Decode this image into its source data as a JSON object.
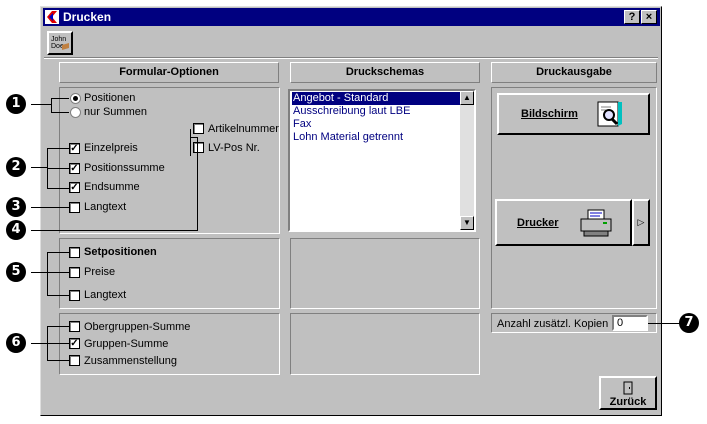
{
  "window": {
    "title": "Drucken",
    "help_button": "?",
    "close_button": "×"
  },
  "toolbar": {
    "john_doe_label": "John Doe"
  },
  "sections": {
    "formular_optionen": "Formular-Optionen",
    "druckschemas": "Druckschemas",
    "druckausgabe": "Druckausgabe"
  },
  "formular": {
    "positionen": "Positionen",
    "nur_summen": "nur Summen",
    "einzelpreis": "Einzelpreis",
    "positionssumme": "Positionssumme",
    "endsumme": "Endsumme",
    "langtext": "Langtext",
    "artikelnummer": "Artikelnummer",
    "lv_pos_nr": "LV-Pos Nr."
  },
  "setpositionen": {
    "title": "Setpositionen",
    "preise": "Preise",
    "langtext": "Langtext"
  },
  "gruppen": {
    "obergruppen_summe": "Obergruppen-Summe",
    "gruppen_summe": "Gruppen-Summe",
    "zusammenstellung": "Zusammenstellung"
  },
  "schemas": {
    "items": [
      "Angebot - Standard",
      "Ausschreibung laut LBE",
      "Fax",
      "Lohn Material getrennt"
    ],
    "selected_index": 0
  },
  "ausgabe": {
    "bildschirm": "Bildschirm",
    "drucker": "Drucker",
    "kopien_label": "Anzahl zusätzl. Kopien",
    "kopien_value": "0",
    "zurueck": "Zurück"
  },
  "callouts": [
    "1",
    "2",
    "3",
    "4",
    "5",
    "6",
    "7"
  ]
}
